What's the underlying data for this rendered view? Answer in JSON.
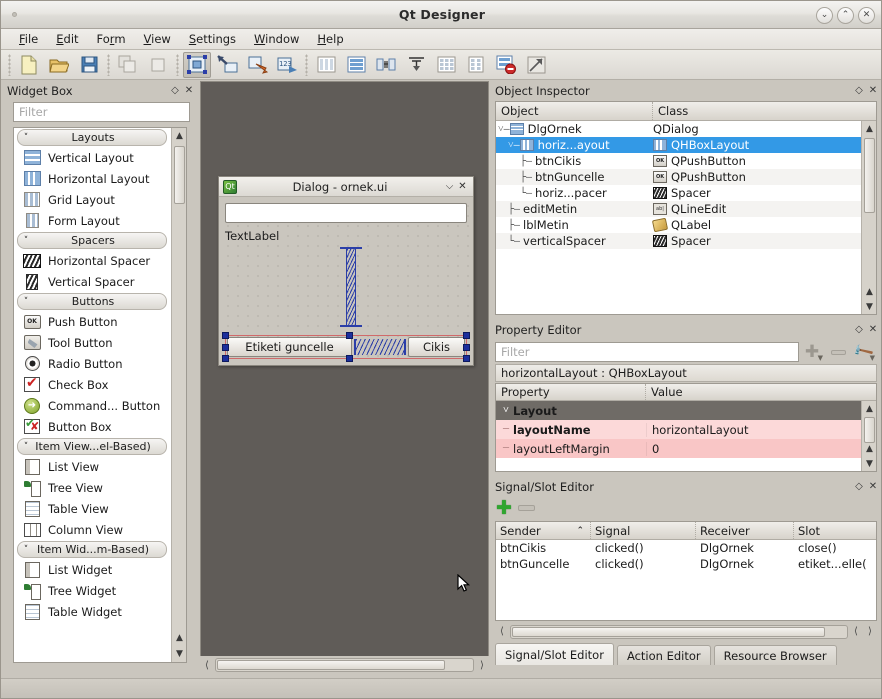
{
  "window": {
    "title": "Qt Designer",
    "controls": [
      {
        "name": "minimize",
        "glyph": "⌄"
      },
      {
        "name": "maximize",
        "glyph": "⌃"
      },
      {
        "name": "close",
        "glyph": "✕"
      }
    ]
  },
  "menubar": {
    "items": [
      {
        "label": "File",
        "mnemonic": "F"
      },
      {
        "label": "Edit",
        "mnemonic": "E"
      },
      {
        "label": "Form",
        "mnemonic": "r"
      },
      {
        "label": "View",
        "mnemonic": "V"
      },
      {
        "label": "Settings",
        "mnemonic": "S"
      },
      {
        "label": "Window",
        "mnemonic": "W"
      },
      {
        "label": "Help",
        "mnemonic": "H"
      }
    ]
  },
  "toolbar": {
    "groups": [
      [
        "new-form-icon",
        "open-form-icon",
        "save-form-icon"
      ],
      [
        "cut-icon",
        "copy-icon"
      ],
      [
        "edit-widgets-icon",
        "edit-signals-slots-icon",
        "edit-buddies-icon",
        "edit-tab-order-icon"
      ],
      [
        "lay-out-horizontally-icon",
        "lay-out-vertically-icon",
        "lay-out-in-splitter-horizontal-icon",
        "lay-out-in-splitter-vertical-icon",
        "lay-out-in-grid-icon",
        "lay-out-in-form-icon",
        "break-layout-icon",
        "adjust-size-icon"
      ]
    ]
  },
  "widget_box": {
    "title": "Widget Box",
    "filter_placeholder": "Filter",
    "categories": [
      {
        "label": "Layouts",
        "items": [
          {
            "label": "Vertical Layout",
            "icon": "vertical-layout-icon"
          },
          {
            "label": "Horizontal Layout",
            "icon": "horizontal-layout-icon"
          },
          {
            "label": "Grid Layout",
            "icon": "grid-layout-icon"
          },
          {
            "label": "Form Layout",
            "icon": "form-layout-icon"
          }
        ]
      },
      {
        "label": "Spacers",
        "items": [
          {
            "label": "Horizontal Spacer",
            "icon": "horizontal-spacer-icon"
          },
          {
            "label": "Vertical Spacer",
            "icon": "vertical-spacer-icon"
          }
        ]
      },
      {
        "label": "Buttons",
        "items": [
          {
            "label": "Push Button",
            "icon": "push-button-icon"
          },
          {
            "label": "Tool Button",
            "icon": "tool-button-icon"
          },
          {
            "label": "Radio Button",
            "icon": "radio-button-icon"
          },
          {
            "label": "Check Box",
            "icon": "check-box-icon"
          },
          {
            "label": "Command... Button",
            "icon": "command-link-button-icon"
          },
          {
            "label": "Button Box",
            "icon": "button-box-icon"
          }
        ]
      },
      {
        "label": "Item View...el-Based)",
        "items": [
          {
            "label": "List View",
            "icon": "list-view-icon"
          },
          {
            "label": "Tree View",
            "icon": "tree-view-icon"
          },
          {
            "label": "Table View",
            "icon": "table-view-icon"
          },
          {
            "label": "Column View",
            "icon": "column-view-icon"
          }
        ]
      },
      {
        "label": "Item Wid...m-Based)",
        "items": [
          {
            "label": "List Widget",
            "icon": "list-widget-icon"
          },
          {
            "label": "Tree Widget",
            "icon": "tree-widget-icon"
          },
          {
            "label": "Table Widget",
            "icon": "table-widget-icon"
          }
        ]
      }
    ]
  },
  "form_canvas": {
    "dialog": {
      "title": "Dialog - ornek.ui",
      "controls": [
        {
          "name": "shade",
          "glyph": "⌵"
        },
        {
          "name": "close",
          "glyph": "✕"
        }
      ],
      "line_edit_value": "",
      "label_text": "TextLabel",
      "buttons": [
        {
          "label": "Etiketi guncelle"
        },
        {
          "label": "Cikis"
        }
      ],
      "spacers": [
        "vertical-spacer",
        "horizontal-spacer"
      ]
    }
  },
  "object_inspector": {
    "title": "Object Inspector",
    "columns": [
      "Object",
      "Class"
    ],
    "rows": [
      {
        "object": "DlgOrnek",
        "class": "QDialog",
        "icon": "vbox-layout-icon",
        "indent": 0,
        "selected": false,
        "expander": "ˇ"
      },
      {
        "object": "horiz...ayout",
        "class": "QHBoxLayout",
        "icon": "hbox-layout-icon",
        "indent": 1,
        "selected": true,
        "expander": "ˇ"
      },
      {
        "object": "btnCikis",
        "class": "QPushButton",
        "icon": "push-button-icon",
        "indent": 2,
        "selected": false,
        "expander": ""
      },
      {
        "object": "btnGuncelle",
        "class": "QPushButton",
        "icon": "push-button-icon",
        "indent": 2,
        "selected": false,
        "expander": ""
      },
      {
        "object": "horiz...pacer",
        "class": "Spacer",
        "icon": "spacer-icon",
        "indent": 2,
        "selected": false,
        "expander": ""
      },
      {
        "object": "editMetin",
        "class": "QLineEdit",
        "icon": "line-edit-icon",
        "indent": 1,
        "selected": false,
        "expander": ""
      },
      {
        "object": "lblMetin",
        "class": "QLabel",
        "icon": "label-icon",
        "indent": 1,
        "selected": false,
        "expander": ""
      },
      {
        "object": "verticalSpacer",
        "class": "Spacer",
        "icon": "spacer-icon",
        "indent": 1,
        "selected": false,
        "expander": ""
      }
    ]
  },
  "property_editor": {
    "title": "Property Editor",
    "filter_placeholder": "Filter",
    "object_line": "horizontalLayout : QHBoxLayout",
    "columns": [
      "Property",
      "Value"
    ],
    "rows": [
      {
        "name": "Layout",
        "value": "",
        "kind": "group"
      },
      {
        "name": "layoutName",
        "value": "horizontalLayout",
        "kind": "bold"
      },
      {
        "name": "layoutLeftMargin",
        "value": "0",
        "kind": "normal"
      }
    ],
    "tools": [
      "add-property-icon",
      "remove-property-icon",
      "configure-icon"
    ]
  },
  "signal_slot_editor": {
    "title": "Signal/Slot Editor",
    "tools": [
      "add-connection-icon",
      "remove-connection-icon"
    ],
    "columns": [
      "Sender",
      "Signal",
      "Receiver",
      "Slot"
    ],
    "sort_indicator": "⌃",
    "rows": [
      {
        "sender": "btnCikis",
        "signal": "clicked()",
        "receiver": "DlgOrnek",
        "slot": "close()"
      },
      {
        "sender": "btnGuncelle",
        "signal": "clicked()",
        "receiver": "DlgOrnek",
        "slot": "etiket...elle("
      }
    ],
    "tabs": [
      {
        "label": "Signal/Slot Editor",
        "active": true
      },
      {
        "label": "Action Editor",
        "active": false
      },
      {
        "label": "Resource Browser",
        "active": false
      }
    ]
  },
  "colors": {
    "selection_blue": "#3399e6",
    "property_group": "#6f6b66",
    "property_row_a": "#fcd9d9",
    "property_row_b": "#f9c6c6",
    "canvas_bg": "#605c58",
    "chrome_bg": "#cac6be",
    "spacer_blue": "#2b3ea8",
    "selection_red": "#d06a6a"
  }
}
